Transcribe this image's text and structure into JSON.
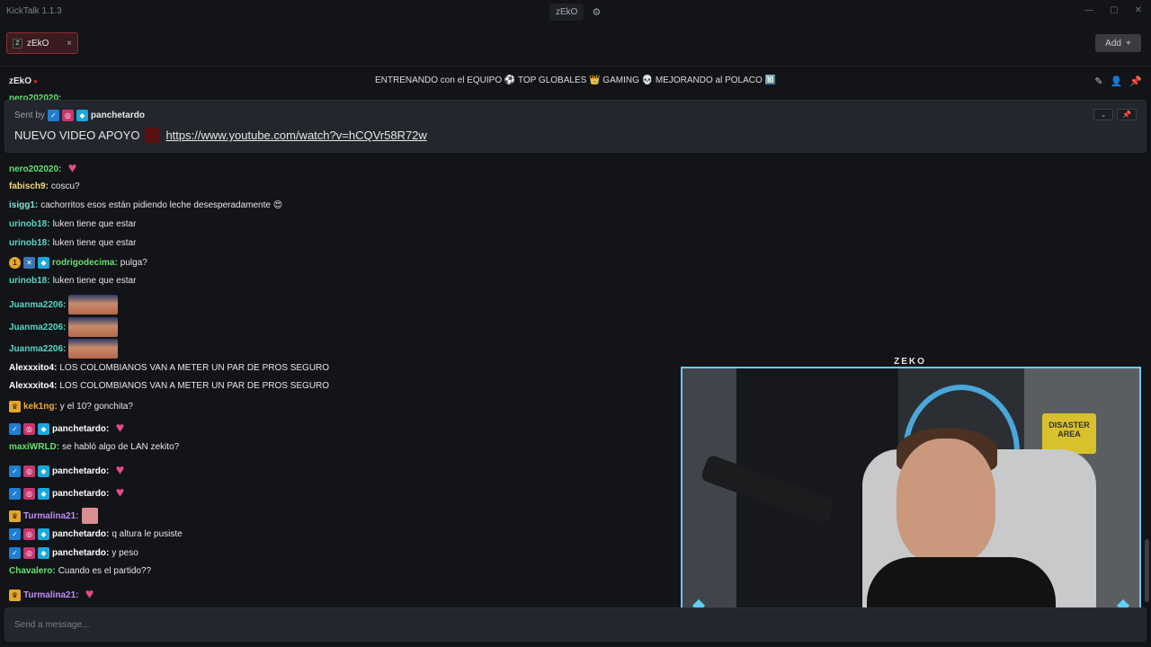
{
  "app": {
    "title": "KickTalk 1.1.3"
  },
  "titlebar": {
    "channel": "zEkO"
  },
  "tabs": [
    {
      "label": "zEkO",
      "close": "×"
    }
  ],
  "add_button": {
    "label": "Add",
    "icon": "+"
  },
  "stream": {
    "name": "zEkO",
    "title": "ENTRENANDO con el EQUIPO ⚽ TOP GLOBALES 👑 GAMING 💀 MEJORANDO al POLACO 🔟"
  },
  "pinned": {
    "sent_by_label": "Sent by",
    "user": "panchetardo",
    "text": "NUEVO VIDEO APOYO",
    "link": "https://www.youtube.com/watch?v=hCQVr58R72w"
  },
  "partial_user": "nero202020:",
  "messages": [
    {
      "user": "nero202020:",
      "color": "#67e06f",
      "text": "",
      "emote": "heart"
    },
    {
      "user": "fabisch9:",
      "color": "#f5d87a",
      "text": "coscu?"
    },
    {
      "user": "isigg1:",
      "color": "#7fe3d4",
      "text": "cachorritos esos están pidiendo leche desesperadamente 😍"
    },
    {
      "user": "urinob18:",
      "color": "#56d5c6",
      "text": "luken tiene que estar"
    },
    {
      "user": "urinob18:",
      "color": "#56d5c6",
      "text": "luken tiene que estar"
    },
    {
      "user": "rodrigodecima:",
      "color": "#67e06f",
      "text": "pulga?",
      "badges": [
        "one",
        "x",
        "cube"
      ]
    },
    {
      "user": "urinob18:",
      "color": "#56d5c6",
      "text": "luken tiene que estar"
    },
    {
      "user": "Juanma2206:",
      "color": "#56d5c6",
      "text": "",
      "emote": "face"
    },
    {
      "user": "Juanma2206:",
      "color": "#56d5c6",
      "text": "",
      "emote": "face"
    },
    {
      "user": "Juanma2206:",
      "color": "#56d5c6",
      "text": "",
      "emote": "face"
    },
    {
      "user": "Alexxxito4:",
      "color": "#ffffff",
      "text": "LOS COLOMBIANOS VAN A METER UN PAR DE PROS SEGURO"
    },
    {
      "user": "Alexxxito4:",
      "color": "#ffffff",
      "text": "LOS COLOMBIANOS VAN A METER UN PAR DE PROS SEGURO"
    },
    {
      "user": "kek1ng:",
      "color": "#f2a93b",
      "text": "y el 10? gonchita?",
      "badges": [
        "crown"
      ]
    },
    {
      "user": "panchetardo:",
      "color": "#ffffff",
      "text": "",
      "emote": "heart",
      "badges": [
        "verified",
        "sub",
        "cube"
      ]
    },
    {
      "user": "maxiWRLD:",
      "color": "#67e06f",
      "text": "se habló algo de LAN zekito?"
    },
    {
      "user": "panchetardo:",
      "color": "#ffffff",
      "text": "",
      "emote": "heart",
      "badges": [
        "verified",
        "sub",
        "cube"
      ]
    },
    {
      "user": "panchetardo:",
      "color": "#ffffff",
      "text": "",
      "emote": "heart",
      "badges": [
        "verified",
        "sub",
        "cube"
      ]
    },
    {
      "user": "Turmalina21:",
      "color": "#c48cf5",
      "text": "",
      "emote": "pink",
      "badges": [
        "crown"
      ]
    },
    {
      "user": "panchetardo:",
      "color": "#ffffff",
      "text": "q altura le pusiste",
      "badges": [
        "verified",
        "sub",
        "cube"
      ]
    },
    {
      "user": "panchetardo:",
      "color": "#ffffff",
      "text": "y peso",
      "badges": [
        "verified",
        "sub",
        "cube"
      ]
    },
    {
      "user": "Chavalero:",
      "color": "#67e06f",
      "text": "Cuando es el partido??"
    },
    {
      "user": "Turmalina21:",
      "color": "#c48cf5",
      "text": "",
      "emote": "heart",
      "badges": [
        "crown"
      ]
    }
  ],
  "composer": {
    "placeholder": "Send a message..."
  },
  "overlay": {
    "logo": "ZEKO",
    "mark": "Z",
    "poster": "DISASTER AREA"
  }
}
